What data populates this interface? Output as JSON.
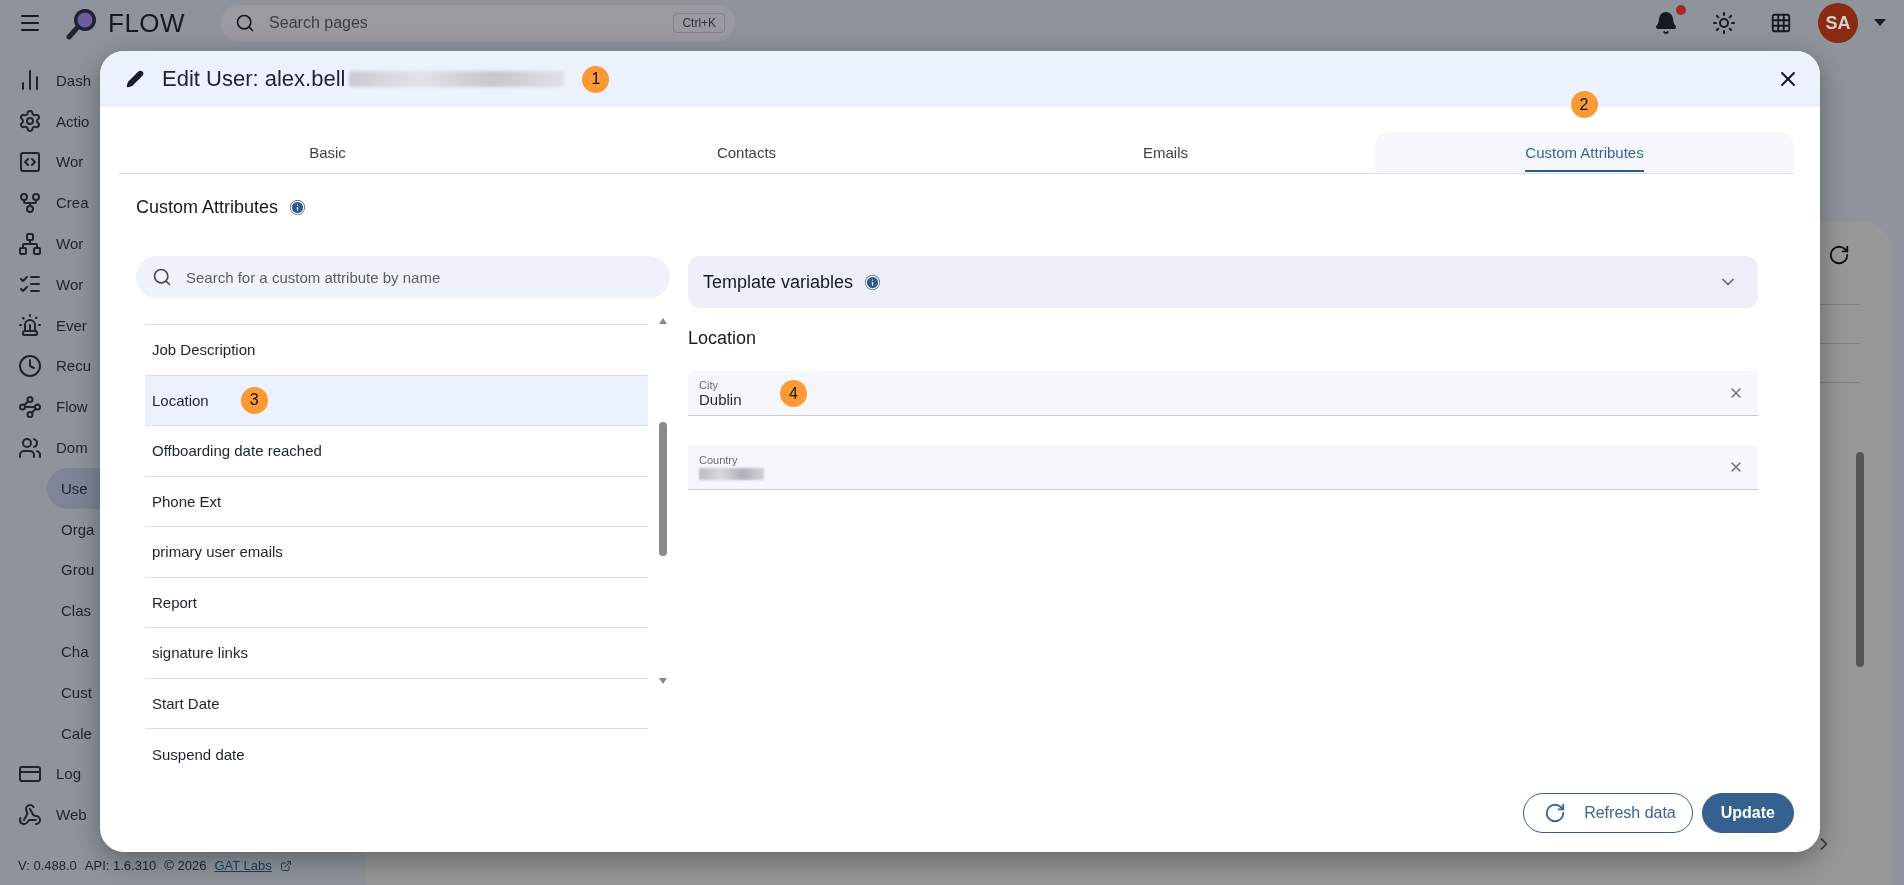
{
  "topbar": {
    "logo_text": "FLOW",
    "search": {
      "placeholder": "Search pages",
      "shortcut": "Ctrl+K"
    },
    "notifications": {
      "unread": true
    },
    "avatar": "SA"
  },
  "sidebar": {
    "items": [
      {
        "label": "Dash",
        "selected": false
      },
      {
        "label": "Actio",
        "selected": false
      },
      {
        "label": "Wor",
        "selected": false
      },
      {
        "label": "Crea",
        "selected": false
      },
      {
        "label": "Wor",
        "selected": false
      },
      {
        "label": "Wor",
        "selected": false
      },
      {
        "label": "Ever",
        "selected": false
      },
      {
        "label": "Recu",
        "selected": false
      },
      {
        "label": "Flow",
        "selected": false
      },
      {
        "label": "Dom",
        "selected": false,
        "children": [
          {
            "label": "Use",
            "selected": true
          },
          {
            "label": "Orga",
            "selected": false
          },
          {
            "label": "Grou",
            "selected": false
          },
          {
            "label": "Clas",
            "selected": false
          },
          {
            "label": "Cha",
            "selected": false
          },
          {
            "label": "Cust",
            "selected": false
          },
          {
            "label": "Cale",
            "selected": false
          }
        ]
      },
      {
        "label": "Log",
        "selected": false
      },
      {
        "label": "Web",
        "selected": false
      }
    ]
  },
  "footer": {
    "version": "V: 0.488.0",
    "api": "API: 1.6.310",
    "copyright": "© 2026",
    "link": "GAT Labs"
  },
  "dialog": {
    "title": "Edit User: alex.bell",
    "title_redacted": true,
    "marker": "1",
    "tabs": [
      {
        "label": "Basic",
        "selected": false
      },
      {
        "label": "Contacts",
        "selected": false
      },
      {
        "label": "Emails",
        "selected": false
      },
      {
        "label": "Custom Attributes",
        "selected": true,
        "marker": "2"
      }
    ],
    "section_title": "Custom Attributes",
    "search": {
      "placeholder": "Search for a custom attribute by name"
    },
    "attributes": [
      {
        "label": "Job Description",
        "selected": false
      },
      {
        "label": "Location",
        "selected": true,
        "marker": "3"
      },
      {
        "label": "Offboarding date reached",
        "selected": false
      },
      {
        "label": "Phone Ext",
        "selected": false
      },
      {
        "label": "primary user emails",
        "selected": false
      },
      {
        "label": "Report",
        "selected": false
      },
      {
        "label": "signature links",
        "selected": false
      },
      {
        "label": "Start Date",
        "selected": false
      },
      {
        "label": "Suspend date",
        "selected": false
      }
    ],
    "template_variables": {
      "title": "Template variables",
      "expanded": false
    },
    "detail_title": "Location",
    "fields": [
      {
        "label": "City",
        "value": "Dublin",
        "redacted": false,
        "marker": "4"
      },
      {
        "label": "Country",
        "redacted": true
      }
    ],
    "buttons": [
      {
        "label": "Refresh data",
        "kind": "outlined"
      },
      {
        "label": "Update",
        "kind": "filled"
      }
    ]
  }
}
